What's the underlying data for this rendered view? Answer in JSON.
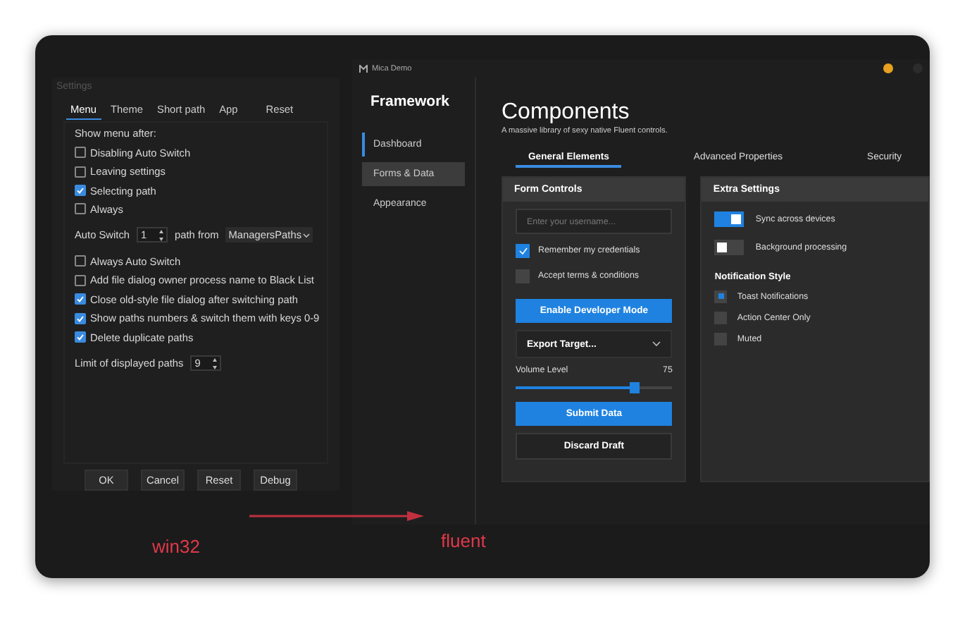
{
  "settings_window": {
    "title": "Settings",
    "tabs": [
      {
        "label": "Menu",
        "selected": true
      },
      {
        "label": "Theme",
        "selected": false
      },
      {
        "label": "Short path",
        "selected": false
      },
      {
        "label": "App",
        "selected": false
      },
      {
        "label": "Reset",
        "selected": false
      }
    ],
    "items": [
      {
        "kind": "heading",
        "label": "Show menu after:"
      },
      {
        "kind": "checkbox",
        "label": "Disabling Auto Switch",
        "checked": false
      },
      {
        "kind": "checkbox",
        "label": "Leaving settings",
        "checked": false
      },
      {
        "kind": "checkbox",
        "label": "Selecting path",
        "checked": true
      },
      {
        "kind": "checkbox",
        "label": "Always",
        "checked": false
      },
      {
        "kind": "auto_switch",
        "label": "Auto Switch",
        "value": "1",
        "middle": "path from",
        "dropdown": "ManagersPaths"
      },
      {
        "kind": "checkbox",
        "label": "Always Auto Switch",
        "checked": false
      },
      {
        "kind": "checkbox",
        "label": "Add file dialog owner process name to Black List",
        "checked": false
      },
      {
        "kind": "checkbox",
        "label": "Close old-style file dialog after switching path",
        "checked": true
      },
      {
        "kind": "checkbox",
        "label": "Show paths numbers & switch them with keys 0-9",
        "checked": true
      },
      {
        "kind": "checkbox",
        "label": "Delete duplicate paths",
        "checked": true
      },
      {
        "kind": "spinner",
        "label": "Limit of displayed paths",
        "value": "9"
      }
    ],
    "buttons": [
      "OK",
      "Cancel",
      "Reset",
      "Debug"
    ]
  },
  "fluent_window": {
    "title": "Mica Demo",
    "sidebar": {
      "title": "Framework",
      "items": [
        {
          "label": "Dashboard",
          "selected": true,
          "highlighted": false
        },
        {
          "label": "Forms & Data",
          "selected": false,
          "highlighted": true
        },
        {
          "label": "Appearance",
          "selected": false,
          "highlighted": false
        }
      ]
    },
    "heading": "Components",
    "subtitle": "A massive library of sexy native Fluent controls.",
    "tabs": [
      {
        "label": "General Elements",
        "selected": true
      },
      {
        "label": "Advanced Properties",
        "selected": false
      },
      {
        "label": "Security",
        "selected": false
      }
    ],
    "form_controls": {
      "title": "Form Controls",
      "placeholder": "Enter your username...",
      "checkboxes": [
        {
          "label": "Remember my credentials",
          "checked": true
        },
        {
          "label": "Accept terms & conditions",
          "checked": false
        }
      ],
      "primary_button": "Enable Developer Mode",
      "dropdown": "Export Target...",
      "slider": {
        "label": "Volume Level",
        "reading": "75",
        "level": 0.75
      },
      "submit_button": "Submit Data",
      "secondary_button": "Discard Draft"
    },
    "extra_settings": {
      "title": "Extra Settings",
      "toggles": [
        {
          "label": "Sync across devices",
          "on": true
        },
        {
          "label": "Background processing",
          "on": false
        }
      ],
      "section": "Notification Style",
      "radios": [
        {
          "label": "Toast Notifications",
          "selected": true
        },
        {
          "label": "Action Center Only",
          "selected": false
        },
        {
          "label": "Muted",
          "selected": false
        }
      ]
    }
  },
  "annotations": {
    "left": "win32",
    "right": "fluent"
  }
}
